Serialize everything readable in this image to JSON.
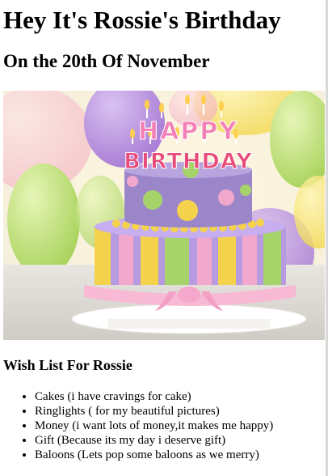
{
  "heading": "Hey It's Rossie's Birthday",
  "subheading": "On the 20th Of November",
  "image": {
    "topper_line1": "HAPPY",
    "topper_line2": "BIRTHDAY"
  },
  "wishlist": {
    "title": "Wish List For Rossie",
    "items": [
      "Cakes (i have cravings for cake)",
      "Ringlights ( for my beautiful pictures)",
      "Money (i want lots of money,it makes me happy)",
      "Gift (Because its my day i deserve gift)",
      "Baloons (Lets pop some baloons as we merry)"
    ]
  },
  "colors": {
    "cake_purple": "#9b86c9",
    "cake_pink": "#f2a8cc",
    "cake_yellow": "#f4d24c",
    "cake_green": "#a6d46a",
    "balloon_purple": "#b487e0",
    "balloon_green": "#bfe38a",
    "balloon_yellow": "#f5e26a"
  }
}
